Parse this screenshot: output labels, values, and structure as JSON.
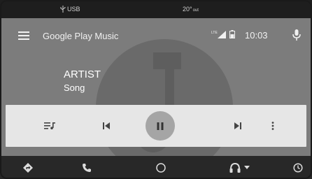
{
  "status_bar": {
    "usb_label": "USB",
    "temperature": "20°",
    "temperature_unit": "out"
  },
  "header": {
    "app_title": "Google Play Music",
    "lte_label": "LTE",
    "time": "10:03"
  },
  "now_playing": {
    "artist": "ARTIST",
    "song": "Song"
  },
  "controls": {
    "icons": [
      "queue-icon",
      "skip-previous-icon",
      "pause-icon",
      "skip-next-icon",
      "more-vert-icon"
    ]
  },
  "nav": {
    "icons": [
      "directions-icon",
      "phone-icon",
      "home-icon",
      "headphones-icon",
      "exit-icon"
    ]
  },
  "colors": {
    "app_background": "#7c7c7c",
    "controls_background": "#e6e6e6",
    "pause_circle": "#a5a5a5",
    "nav_background": "#282828"
  }
}
